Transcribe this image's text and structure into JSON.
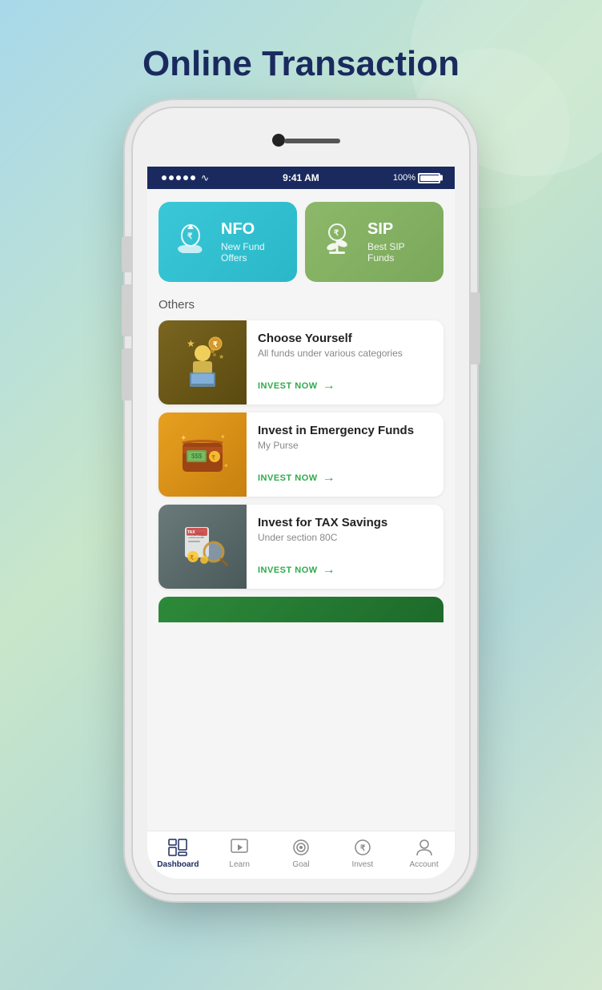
{
  "page": {
    "title": "Online Transaction",
    "bg_gradient_start": "#a8d8ea",
    "bg_gradient_end": "#c8e6c9"
  },
  "status_bar": {
    "time": "9:41 AM",
    "battery_text": "100%"
  },
  "cards": {
    "nfo": {
      "title": "NFO",
      "subtitle": "New Fund Offers",
      "color_start": "#3ac8d8",
      "color_end": "#2ab8c8"
    },
    "sip": {
      "title": "SIP",
      "subtitle": "Best SIP Funds",
      "color_start": "#8db86a",
      "color_end": "#7aa85a"
    }
  },
  "others_label": "Others",
  "list_items": [
    {
      "title": "Choose Yourself",
      "subtitle": "All funds under various categories",
      "cta": "INVEST NOW",
      "bg_class": "item-choose"
    },
    {
      "title": "Invest in Emergency Funds",
      "subtitle": "My Purse",
      "cta": "INVEST NOW",
      "bg_class": "item-emergency"
    },
    {
      "title": "Invest for TAX Savings",
      "subtitle": "Under section 80C",
      "cta": "INVEST NOW",
      "bg_class": "item-tax"
    }
  ],
  "nav": {
    "items": [
      {
        "label": "Dashboard",
        "icon": "dashboard-icon",
        "active": true
      },
      {
        "label": "Learn",
        "icon": "learn-icon",
        "active": false
      },
      {
        "label": "Goal",
        "icon": "goal-icon",
        "active": false
      },
      {
        "label": "Invest",
        "icon": "invest-icon",
        "active": false
      },
      {
        "label": "Account",
        "icon": "account-icon",
        "active": false
      }
    ]
  }
}
